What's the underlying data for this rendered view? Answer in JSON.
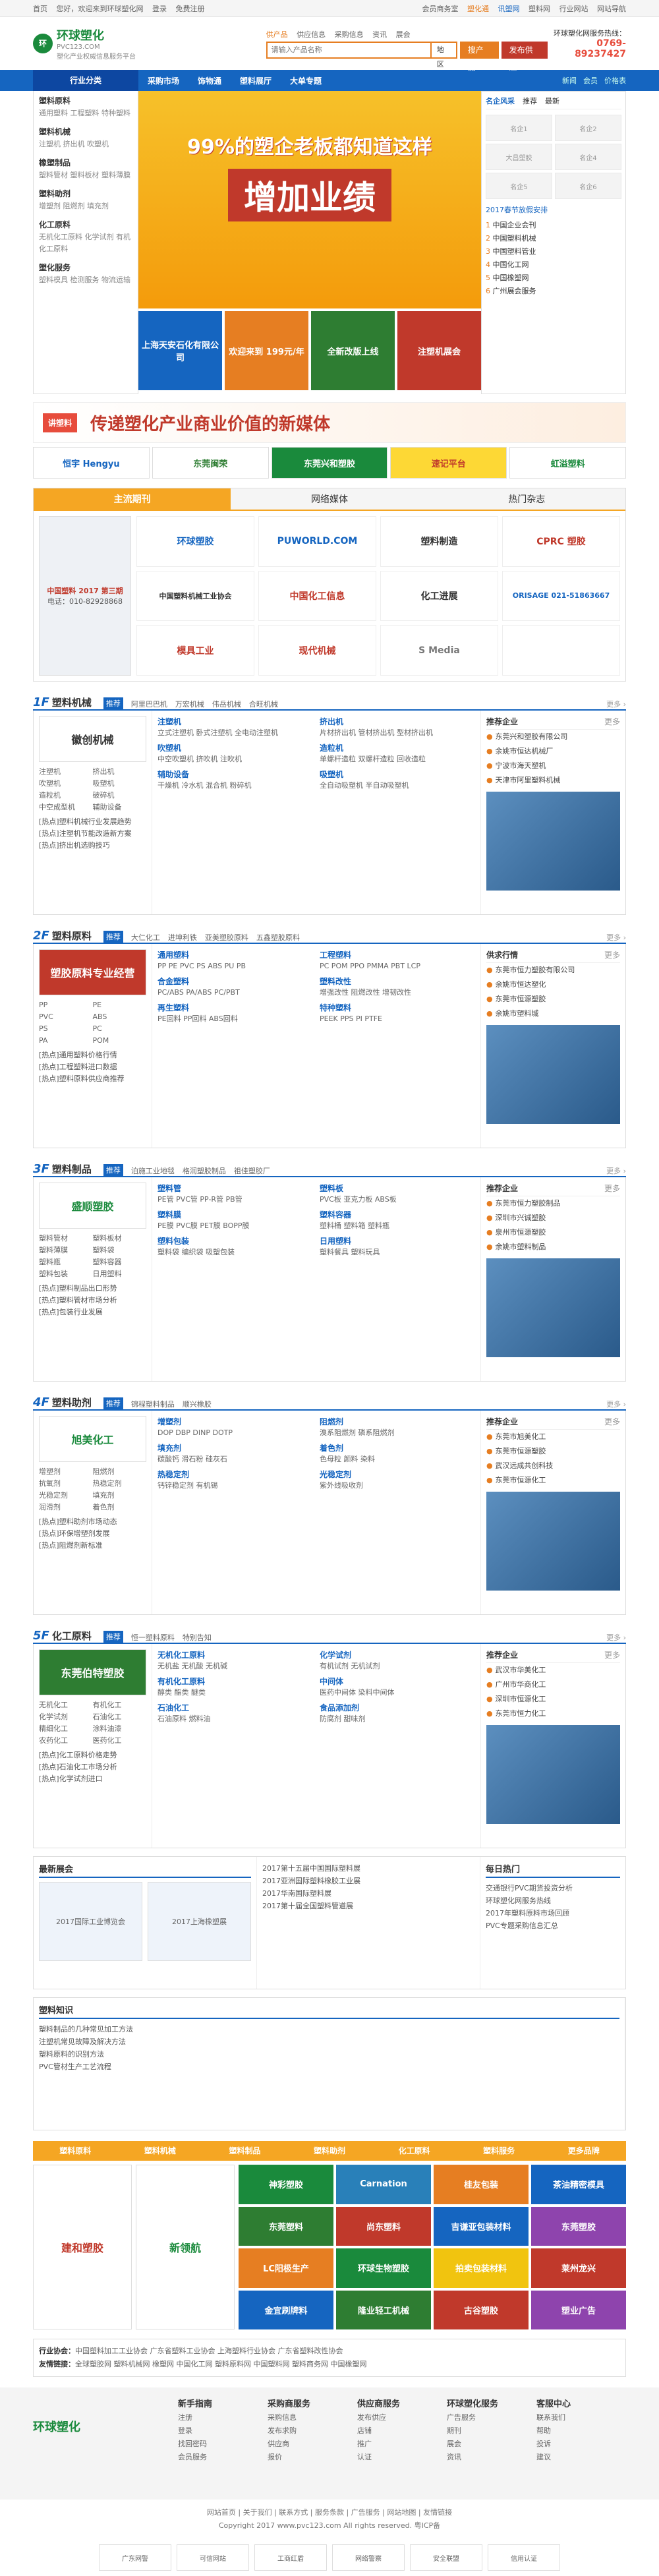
{
  "top": {
    "links": [
      "首页",
      "您好，欢迎来到环球塑化网",
      "登录",
      "免费注册"
    ],
    "right": [
      "会员商务室",
      "塑化通",
      "讯塑网",
      "塑料网",
      "行业网站",
      "网站导航"
    ]
  },
  "header": {
    "logo_title": "环球塑化",
    "logo_domain": "PVC123.COM",
    "logo_slogan": "塑化产业权威信息服务平台",
    "search_tabs": [
      "供产品",
      "供应信息",
      "采购信息",
      "资讯",
      "展会"
    ],
    "search_placeholder": "请输入产品名称",
    "search_loc": "地区",
    "search_btn": "搜产品",
    "post_btn": "发布供应",
    "hotline_label": "环球塑化网服务热线：",
    "hotline": "0769-89237427"
  },
  "nav": {
    "cat": "行业分类",
    "items": [
      "采购市场",
      "饰物通",
      "塑料展厅",
      "大单专题"
    ],
    "right": [
      "新闻",
      "会员",
      "价格表"
    ]
  },
  "categories": [
    {
      "title": "塑料原料",
      "links": "通用塑料 工程塑料 特种塑料"
    },
    {
      "title": "塑料机械",
      "links": "注塑机 挤出机 吹塑机"
    },
    {
      "title": "橡塑制品",
      "links": "塑料管材 塑料板材 塑料薄膜"
    },
    {
      "title": "塑料助剂",
      "links": "增塑剂 阻燃剂 填充剂"
    },
    {
      "title": "化工原料",
      "links": "无机化工原料 化学试剂 有机化工原料"
    },
    {
      "title": "塑化服务",
      "links": "塑料模具 检测服务 物流运输"
    }
  ],
  "banner": {
    "line1": "99%的塑企老板都知道这样",
    "line2": "增加业绩",
    "smalls": [
      "上海天安石化有限公司",
      "欢迎来到 199元/年",
      "全新改版上线",
      "注塑机展会"
    ]
  },
  "side": {
    "tabs": [
      "名企风采",
      "推荐",
      "最新"
    ],
    "logos": [
      "名企1",
      "名企2",
      "大昌塑胶",
      "名企4",
      "名企5",
      "名企6"
    ],
    "period": "2017春节放假安排",
    "rank": [
      "中国企业会刊",
      "中国塑料机械",
      "中国塑料管业",
      "中国化工网",
      "中国橡塑网",
      "广州展会服务"
    ]
  },
  "adbanner": {
    "big": "传递塑化产业商业价值的新媒体",
    "tag": "讲塑料"
  },
  "logobar": [
    "恒宇 Hengyu",
    "东莞闽荣",
    "东莞兴和塑胶",
    "速记平台",
    "虹溢塑料"
  ],
  "mags": {
    "tabs": [
      "主流期刊",
      "网络媒体",
      "热门杂志"
    ],
    "cover": "中国塑料 2017 第三期",
    "phone": "电话：010-82928868",
    "logos": [
      "环球塑胶",
      "PUWORLD.COM",
      "塑料制造",
      "CPRC 塑胶",
      "中国塑料机械工业协会",
      "中国化工信息",
      "化工进展",
      "ORISAGE 021-51863667",
      "模具工业",
      "现代机械",
      "S Media"
    ]
  },
  "floors": [
    {
      "num": "1F",
      "name": "塑料机械",
      "subs": [
        "推荐",
        "阿里巴巴机",
        "万宏机械",
        "伟岳机械",
        "合旺机械"
      ],
      "ad": "徽创机械",
      "ad_color": "#ffffff",
      "ad_text": "#333333",
      "cats": [
        "注塑机",
        "挤出机",
        "吹塑机",
        "吸塑机",
        "造粒机",
        "破碎机",
        "中空成型机",
        "辅助设备"
      ],
      "news": [
        "[热点]塑料机械行业发展趋势",
        "[热点]注塑机节能改造新方案",
        "[热点]挤出机选购技巧"
      ],
      "blocks": [
        {
          "t": "注塑机",
          "l": "立式注塑机 卧式注塑机 全电动注塑机"
        },
        {
          "t": "挤出机",
          "l": "片材挤出机 管材挤出机 型材挤出机"
        },
        {
          "t": "吹塑机",
          "l": "中空吹塑机 挤吹机 注吹机"
        },
        {
          "t": "造粒机",
          "l": "单螺杆造粒 双螺杆造粒 回收造粒"
        },
        {
          "t": "辅助设备",
          "l": "干燥机 冷水机 混合机 粉碎机"
        },
        {
          "t": "吸塑机",
          "l": "全自动吸塑机 半自动吸塑机"
        }
      ],
      "rtitle": "推荐企业",
      "companies": [
        "东莞兴和塑胶有限公司",
        "余姚市恒达机械厂",
        "宁波市海天塑机",
        "天津市阿里塑料机械"
      ]
    },
    {
      "num": "2F",
      "name": "塑料原料",
      "subs": [
        "推荐",
        "大仁化工",
        "进坤利铁",
        "亚美塑胶原料",
        "五鑫塑胶原料"
      ],
      "ad": "塑胶原料专业经营",
      "ad_color": "#c0392b",
      "ad_text": "#ffffff",
      "cats": [
        "PP",
        "PE",
        "PVC",
        "ABS",
        "PS",
        "PC",
        "PA",
        "POM"
      ],
      "news": [
        "[热点]通用塑料价格行情",
        "[热点]工程塑料进口数据",
        "[热点]塑料原料供应商推荐"
      ],
      "blocks": [
        {
          "t": "通用塑料",
          "l": "PP PE PVC PS ABS PU PB"
        },
        {
          "t": "工程塑料",
          "l": "PC POM PPO PMMA PBT LCP"
        },
        {
          "t": "合金塑料",
          "l": "PC/ABS PA/ABS PC/PBT"
        },
        {
          "t": "塑料改性",
          "l": "增强改性 阻燃改性 增韧改性"
        },
        {
          "t": "再生塑料",
          "l": "PE回料 PP回料 ABS回料"
        },
        {
          "t": "特种塑料",
          "l": "PEEK PPS PI PTFE"
        }
      ],
      "rtitle": "供求行情",
      "companies": [
        "东莞市恒力塑胶有限公司",
        "余姚市恒达塑化",
        "东莞市恒源塑胶",
        "余姚市塑料城"
      ]
    },
    {
      "num": "3F",
      "name": "塑料制品",
      "subs": [
        "推荐",
        "泊施工业地毯",
        "格润塑胶制品",
        "祖佳塑胶厂"
      ],
      "ad": "盛顺塑胶",
      "ad_color": "#ffffff",
      "ad_text": "#1a8a3c",
      "cats": [
        "塑料管材",
        "塑料板材",
        "塑料薄膜",
        "塑料袋",
        "塑料瓶",
        "塑料容器",
        "塑料包装",
        "日用塑料"
      ],
      "news": [
        "[热点]塑料制品出口形势",
        "[热点]塑料管材市场分析",
        "[热点]包装行业发展"
      ],
      "blocks": [
        {
          "t": "塑料管",
          "l": "PE管 PVC管 PP-R管 PB管"
        },
        {
          "t": "塑料板",
          "l": "PVC板 亚克力板 ABS板"
        },
        {
          "t": "塑料膜",
          "l": "PE膜 PVC膜 PET膜 BOPP膜"
        },
        {
          "t": "塑料容器",
          "l": "塑料桶 塑料箱 塑料瓶"
        },
        {
          "t": "塑料包装",
          "l": "塑料袋 编织袋 吸塑包装"
        },
        {
          "t": "日用塑料",
          "l": "塑料餐具 塑料玩具"
        }
      ],
      "rtitle": "推荐企业",
      "companies": [
        "东莞市恒力塑胶制品",
        "深圳市兴诚塑胶",
        "泉州市恒源塑胶",
        "余姚市塑料制品"
      ]
    },
    {
      "num": "4F",
      "name": "塑料助剂",
      "subs": [
        "推荐",
        "锦程塑料制品",
        "顺兴橡胶"
      ],
      "ad": "旭美化工",
      "ad_color": "#ffffff",
      "ad_text": "#1a8a3c",
      "cats": [
        "增塑剂",
        "阻燃剂",
        "抗氧剂",
        "热稳定剂",
        "光稳定剂",
        "填充剂",
        "润滑剂",
        "着色剂"
      ],
      "news": [
        "[热点]塑料助剂市场动态",
        "[热点]环保增塑剂发展",
        "[热点]阻燃剂新标准"
      ],
      "blocks": [
        {
          "t": "增塑剂",
          "l": "DOP DBP DINP DOTP"
        },
        {
          "t": "阻燃剂",
          "l": "溴系阻燃剂 磷系阻燃剂"
        },
        {
          "t": "填充剂",
          "l": "碳酸钙 滑石粉 硅灰石"
        },
        {
          "t": "着色剂",
          "l": "色母粒 颜料 染料"
        },
        {
          "t": "热稳定剂",
          "l": "钙锌稳定剂 有机锡"
        },
        {
          "t": "光稳定剂",
          "l": "紫外线吸收剂"
        }
      ],
      "rtitle": "推荐企业",
      "companies": [
        "东莞市旭美化工",
        "东莞市恒源塑胶",
        "武汉远成共创科技",
        "东莞市恒源化工"
      ]
    },
    {
      "num": "5F",
      "name": "化工原料",
      "subs": [
        "推荐",
        "恒一塑料原料",
        "特别告知"
      ],
      "ad": "东莞伯特塑胶",
      "ad_color": "#2e7d32",
      "ad_text": "#ffffff",
      "cats": [
        "无机化工",
        "有机化工",
        "化学试剂",
        "石油化工",
        "精细化工",
        "涂料油漆",
        "农药化工",
        "医药化工"
      ],
      "news": [
        "[热点]化工原料价格走势",
        "[热点]石油化工市场分析",
        "[热点]化学试剂进口"
      ],
      "blocks": [
        {
          "t": "无机化工原料",
          "l": "无机盐 无机酸 无机碱"
        },
        {
          "t": "化学试剂",
          "l": "有机试剂 无机试剂"
        },
        {
          "t": "有机化工原料",
          "l": "醇类 酯类 醚类"
        },
        {
          "t": "中间体",
          "l": "医药中间体 染料中间体"
        },
        {
          "t": "石油化工",
          "l": "石油原料 燃料油"
        },
        {
          "t": "食品添加剂",
          "l": "防腐剂 甜味剂"
        }
      ],
      "rtitle": "推荐企业",
      "companies": [
        "武汉市华美化工",
        "广州市华商化工",
        "深圳市恒源化工",
        "东莞市恒力化工"
      ]
    }
  ],
  "news": {
    "expo_title": "最新展会",
    "expos": [
      "2017国际工业博览会",
      "2017上海橡塑展"
    ],
    "expo_list": [
      "2017第十五届中国国际塑料展",
      "2017亚洲国际塑料橡胶工业展",
      "2017华南国际塑料展",
      "2017第十届全国塑料管道展"
    ],
    "knowledge_title": "塑料知识",
    "knowledge": [
      "塑料制品的几种常见加工方法",
      "注塑机常见故障及解决方法",
      "塑料原料的识别方法",
      "PVC管材生产工艺流程"
    ],
    "right_title": "每日热门",
    "right": [
      "交通银行PVC期货投资分析",
      "环球塑化网服务热线",
      "2017年塑料原料市场回顾",
      "PVC专题采购信息汇总"
    ]
  },
  "bottom": {
    "cats": [
      "塑料原料",
      "塑料机械",
      "塑料制品",
      "塑料助剂",
      "化工原料",
      "塑料服务",
      "更多品牌"
    ],
    "tall1": "建和塑胶",
    "tall2": "新领航",
    "grid": [
      "神彩塑胶",
      "Carnation",
      "桂友包装",
      "茶油精密模具",
      "东莞塑料",
      "尚东塑料",
      "吉谦亚包装材料",
      "东莞塑胶",
      "LC阳极生产",
      "环球生物塑胶",
      "拍卖包装材料",
      "莱州龙兴",
      "金宜刷牌料",
      "隆业轻工机械",
      "古谷塑胶",
      "塑业广告"
    ],
    "gridcolors": [
      "#1a8a3c",
      "#2980b9",
      "#e67e22",
      "#1565c0",
      "#2e7d32",
      "#c0392b",
      "#1565c0",
      "#8e44ad",
      "#e67e22",
      "#1a8a3c",
      "#f1c40f",
      "#c0392b",
      "#1565c0",
      "#2e7d32",
      "#c0392b",
      "#8e44ad"
    ]
  },
  "links": {
    "label1": "行业协会：",
    "items1": "中国塑料加工工业协会 广东省塑料工业协会 上海塑料行业协会 广东省塑料改性协会",
    "label2": "友情链接：",
    "items2": "全球塑胶网 塑料机械网 橡塑网 中国化工网 塑料原料网 中国塑料网 塑料商务网 中国橡塑网"
  },
  "footer": {
    "logo": "环球塑化",
    "cols": [
      {
        "t": "新手指南",
        "l": [
          "注册",
          "登录",
          "找回密码",
          "会员服务"
        ]
      },
      {
        "t": "采购商服务",
        "l": [
          "采购信息",
          "发布求购",
          "供应商",
          "报价"
        ]
      },
      {
        "t": "供应商服务",
        "l": [
          "发布供应",
          "店铺",
          "推广",
          "认证"
        ]
      },
      {
        "t": "环球塑化服务",
        "l": [
          "广告服务",
          "期刊",
          "展会",
          "资讯"
        ]
      },
      {
        "t": "客服中心",
        "l": [
          "联系我们",
          "帮助",
          "投诉",
          "建议"
        ]
      }
    ],
    "copy1": "网站首页 | 关于我们 | 联系方式 | 服务条款 | 广告服务 | 网站地图 | 友情链接",
    "copy2": "Copyright 2017 www.pvc123.com All rights reserved. 粤ICP备",
    "badges": [
      "广东网警",
      "可信网站",
      "工商红盾",
      "网络警察",
      "安全联盟",
      "信用认证"
    ]
  }
}
